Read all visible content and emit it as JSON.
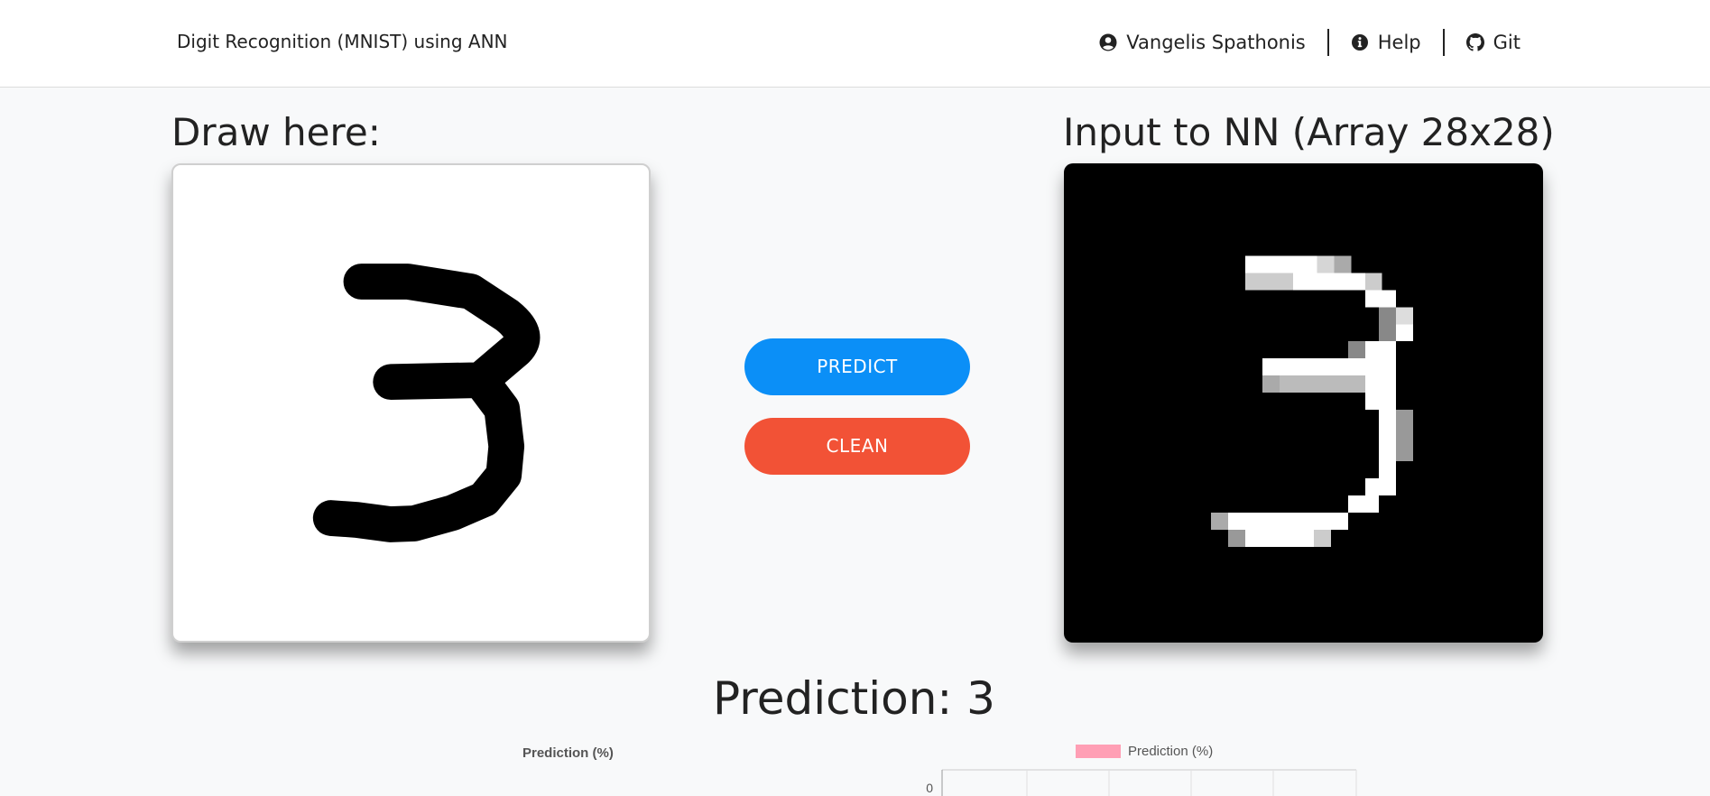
{
  "navbar": {
    "brand": "Digit Recognition (MNIST) using ANN",
    "links": [
      {
        "label": "Vangelis Spathonis",
        "icon": "user-circle-icon"
      },
      {
        "label": "Help",
        "icon": "info-circle-icon"
      },
      {
        "label": "Git",
        "icon": "github-icon"
      }
    ]
  },
  "draw": {
    "heading": "Draw here:"
  },
  "nn_input": {
    "heading": "Input to NN (Array 28x28)"
  },
  "buttons": {
    "predict": "PREDICT",
    "clean": "CLEAN"
  },
  "prediction": {
    "text": "Prediction: 3"
  },
  "chart": {
    "title": "Prediction (%)",
    "legend": "Prediction (%)",
    "color": "#ff9fb5",
    "y_tick": "0"
  },
  "colors": {
    "primary": "#0b8ff7",
    "danger": "#f25236"
  }
}
